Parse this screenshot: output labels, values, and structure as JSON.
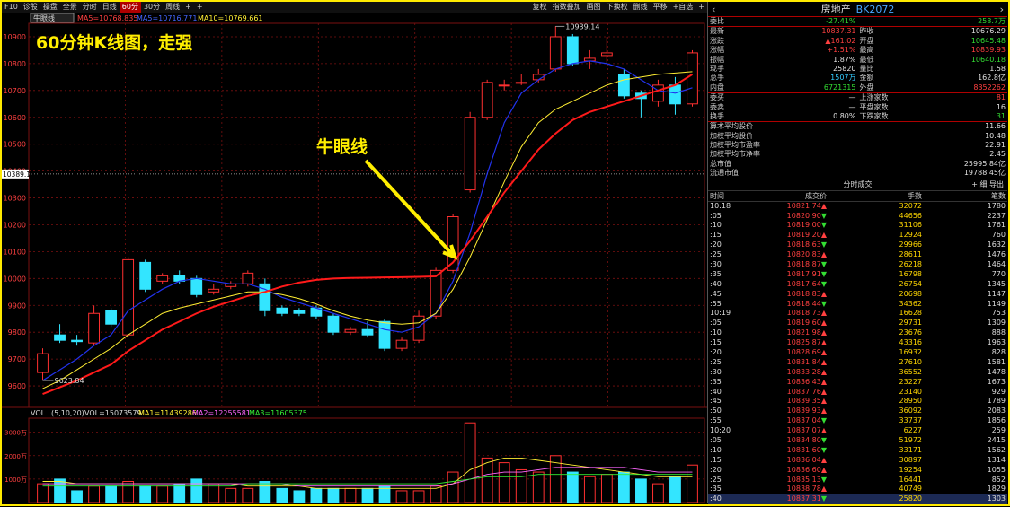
{
  "toolbar": {
    "left": [
      "F10",
      "诊股",
      "操盘",
      "全景"
    ],
    "periods": [
      "分时",
      "日线",
      "60分",
      "30分",
      "周线",
      "+",
      "+"
    ],
    "active_period": "60分",
    "right": [
      "复权",
      "指数叠加",
      "画图",
      "下换权",
      "删线",
      "平移",
      "+自选",
      "+"
    ]
  },
  "indicator_bar": {
    "ma_label": "牛眼线",
    "ma1": "MA5=10768.835",
    "ma2": "MA5=10716.771",
    "ma3": "MA10=10769.661"
  },
  "annotation": {
    "headline": "60分钟K线图，走强",
    "callout": "牛眼线"
  },
  "price_axis": {
    "ticks": [
      "10900",
      "10800",
      "10700",
      "10600",
      "10500",
      "10400",
      "10300",
      "10200",
      "10100",
      "10000",
      "9900",
      "9800",
      "9700",
      "9600"
    ],
    "current_tag": "10389.15",
    "high_label": "10939.14",
    "low_label": "9623.84"
  },
  "volume_panel": {
    "title": "VOL",
    "params": "(5,10,20)",
    "vol": "VOL=15073579",
    "ma1": "MA1=11439286",
    "ma2": "MA2=12255581",
    "ma3": "MA3=11605375",
    "ticks": [
      "3000万",
      "2000万",
      "1000万"
    ]
  },
  "chart_data": {
    "type": "candlestick",
    "candles": [
      {
        "o": 9650,
        "c": 9720,
        "h": 9740,
        "l": 9620
      },
      {
        "o": 9790,
        "c": 9770,
        "h": 9830,
        "l": 9760
      },
      {
        "o": 9770,
        "c": 9765,
        "h": 9790,
        "l": 9750
      },
      {
        "o": 9760,
        "c": 9870,
        "h": 9900,
        "l": 9750
      },
      {
        "o": 9880,
        "c": 9830,
        "h": 9890,
        "l": 9820
      },
      {
        "o": 9790,
        "c": 10070,
        "h": 10080,
        "l": 9780
      },
      {
        "o": 10060,
        "c": 9960,
        "h": 10070,
        "l": 9950
      },
      {
        "o": 9990,
        "c": 10010,
        "h": 10020,
        "l": 9980
      },
      {
        "o": 10010,
        "c": 9990,
        "h": 10030,
        "l": 9980
      },
      {
        "o": 10000,
        "c": 9940,
        "h": 10010,
        "l": 9930
      },
      {
        "o": 9950,
        "c": 9960,
        "h": 9980,
        "l": 9940
      },
      {
        "o": 9970,
        "c": 9980,
        "h": 9990,
        "l": 9960
      },
      {
        "o": 9980,
        "c": 10020,
        "h": 10030,
        "l": 9970
      },
      {
        "o": 9980,
        "c": 9880,
        "h": 10000,
        "l": 9860
      },
      {
        "o": 9890,
        "c": 9870,
        "h": 9900,
        "l": 9860
      },
      {
        "o": 9880,
        "c": 9870,
        "h": 9890,
        "l": 9860
      },
      {
        "o": 9890,
        "c": 9860,
        "h": 9900,
        "l": 9850
      },
      {
        "o": 9860,
        "c": 9800,
        "h": 9870,
        "l": 9790
      },
      {
        "o": 9800,
        "c": 9810,
        "h": 9820,
        "l": 9790
      },
      {
        "o": 9810,
        "c": 9790,
        "h": 9840,
        "l": 9780
      },
      {
        "o": 9840,
        "c": 9740,
        "h": 9850,
        "l": 9730
      },
      {
        "o": 9740,
        "c": 9770,
        "h": 9780,
        "l": 9730
      },
      {
        "o": 9770,
        "c": 9860,
        "h": 9880,
        "l": 9760
      },
      {
        "o": 9860,
        "c": 10030,
        "h": 10040,
        "l": 9850
      },
      {
        "o": 10030,
        "c": 10230,
        "h": 10240,
        "l": 10020
      },
      {
        "o": 10330,
        "c": 10600,
        "h": 10620,
        "l": 10320
      },
      {
        "o": 10600,
        "c": 10730,
        "h": 10740,
        "l": 10590
      },
      {
        "o": 10720,
        "c": 10720,
        "h": 10740,
        "l": 10700
      },
      {
        "o": 10730,
        "c": 10730,
        "h": 10760,
        "l": 10720
      },
      {
        "o": 10740,
        "c": 10760,
        "h": 10780,
        "l": 10730
      },
      {
        "o": 10780,
        "c": 10900,
        "h": 10939,
        "l": 10770
      },
      {
        "o": 10900,
        "c": 10800,
        "h": 10910,
        "l": 10790
      },
      {
        "o": 10810,
        "c": 10820,
        "h": 10850,
        "l": 10780
      },
      {
        "o": 10830,
        "c": 10840,
        "h": 10900,
        "l": 10800
      },
      {
        "o": 10760,
        "c": 10680,
        "h": 10780,
        "l": 10670
      },
      {
        "o": 10690,
        "c": 10670,
        "h": 10700,
        "l": 10600
      },
      {
        "o": 10660,
        "c": 10720,
        "h": 10740,
        "l": 10640
      },
      {
        "o": 10720,
        "c": 10650,
        "h": 10750,
        "l": 10610
      },
      {
        "o": 10650,
        "c": 10840,
        "h": 10850,
        "l": 10640
      }
    ],
    "ma_red": [
      9570,
      9595,
      9620,
      9650,
      9680,
      9730,
      9770,
      9810,
      9840,
      9870,
      9895,
      9915,
      9935,
      9950,
      9970,
      9985,
      9995,
      10000,
      10002,
      10003,
      10004,
      10005,
      10006,
      10008,
      10060,
      10140,
      10230,
      10320,
      10400,
      10480,
      10540,
      10590,
      10620,
      10640,
      10660,
      10680,
      10700,
      10720,
      10760
    ],
    "ma_yellow": [
      9590,
      9620,
      9660,
      9700,
      9740,
      9790,
      9830,
      9870,
      9890,
      9905,
      9920,
      9935,
      9950,
      9950,
      9940,
      9925,
      9905,
      9880,
      9860,
      9845,
      9835,
      9830,
      9835,
      9870,
      9960,
      10080,
      10220,
      10360,
      10490,
      10580,
      10630,
      10660,
      10690,
      10720,
      10740,
      10750,
      10760,
      10765,
      10770
    ],
    "ma_blue": [
      9620,
      9660,
      9700,
      9750,
      9790,
      9880,
      9920,
      9960,
      9990,
      10000,
      9990,
      9980,
      9980,
      9960,
      9930,
      9910,
      9890,
      9870,
      9850,
      9830,
      9810,
      9800,
      9820,
      9870,
      9990,
      10170,
      10390,
      10580,
      10690,
      10740,
      10780,
      10800,
      10810,
      10800,
      10780,
      10740,
      10700,
      10690,
      10710
    ],
    "volume": [
      8,
      10,
      5,
      7,
      7,
      9,
      7,
      7,
      8,
      10,
      8,
      6,
      6,
      9,
      6,
      5,
      6,
      6,
      6,
      6,
      7,
      5,
      5,
      7,
      13,
      34,
      19,
      17,
      14,
      13,
      20,
      13,
      11,
      12,
      13,
      10,
      8,
      11,
      16
    ],
    "vol_ma1": [
      9,
      9,
      8,
      8,
      8,
      8,
      8,
      8,
      8,
      8,
      8,
      8,
      7,
      7,
      7,
      7,
      6,
      6,
      6,
      6,
      6,
      6,
      6,
      6,
      8,
      14,
      17,
      19,
      19,
      18,
      17,
      16,
      15,
      14,
      13,
      12,
      11,
      11,
      11
    ],
    "vol_ma2": [
      8,
      8,
      8,
      8,
      8,
      8,
      8,
      8,
      8,
      8,
      8,
      8,
      8,
      8,
      8,
      7,
      7,
      7,
      7,
      7,
      7,
      7,
      7,
      7,
      8,
      10,
      12,
      13,
      13,
      14,
      15,
      15,
      15,
      15,
      15,
      14,
      13,
      13,
      13
    ],
    "vol_ma3": [
      7,
      7,
      7,
      7,
      7,
      7,
      7,
      7,
      7,
      7,
      7,
      7,
      8,
      8,
      8,
      8,
      8,
      8,
      8,
      8,
      8,
      8,
      8,
      8,
      9,
      10,
      11,
      11,
      11,
      12,
      12,
      12,
      12,
      12,
      12,
      12,
      12,
      12,
      12
    ]
  },
  "stock_header": {
    "name": "房地产",
    "code": "BK2072"
  },
  "quote_rows": [
    [
      {
        "l": "委比",
        "v": "-27.41%",
        "c": "green"
      },
      {
        "l": "",
        "v": "258.7万",
        "c": "green"
      }
    ],
    [
      {
        "l": "最新",
        "v": "10837.31",
        "c": "red"
      },
      {
        "l": "昨收",
        "v": "10676.29",
        "c": "white"
      }
    ],
    [
      {
        "l": "涨跌",
        "v": "▲161.02",
        "c": "red"
      },
      {
        "l": "开盘",
        "v": "10645.48",
        "c": "green"
      }
    ],
    [
      {
        "l": "涨幅",
        "v": "+1.51%",
        "c": "red"
      },
      {
        "l": "最高",
        "v": "10839.93",
        "c": "red"
      }
    ],
    [
      {
        "l": "振幅",
        "v": "1.87%",
        "c": "white"
      },
      {
        "l": "最低",
        "v": "10640.18",
        "c": "green"
      }
    ],
    [
      {
        "l": "现手",
        "v": "25820",
        "c": "white"
      },
      {
        "l": "量比",
        "v": "1.58",
        "c": "white"
      }
    ],
    [
      {
        "l": "总手",
        "v": "1507万",
        "c": "cyan"
      },
      {
        "l": "金额",
        "v": "162.8亿",
        "c": "white"
      }
    ],
    [
      {
        "l": "内盘",
        "v": "6721315",
        "c": "green"
      },
      {
        "l": "外盘",
        "v": "8352262",
        "c": "red"
      }
    ]
  ],
  "breadth_rows": [
    {
      "l": "委买",
      "m": "—",
      "ml": "上涨家数",
      "v": "81",
      "c": "red"
    },
    {
      "l": "委卖",
      "m": "—",
      "ml": "平盘家数",
      "v": "16",
      "c": "white"
    },
    {
      "l": "换手",
      "m": "0.80%",
      "ml": "下跌家数",
      "v": "31",
      "c": "green"
    }
  ],
  "stats_rows": [
    {
      "l": "算术平均股价",
      "v": "11.66"
    },
    {
      "l": "加权平均股价",
      "v": "10.48"
    },
    {
      "l": "加权平均市盈率",
      "v": "22.91"
    },
    {
      "l": "加权平均市净率",
      "v": "2.45"
    },
    {
      "l": "总市值",
      "v": "25995.84亿"
    },
    {
      "l": "流通市值",
      "v": "19788.45亿"
    }
  ],
  "trades_panel": {
    "title": "分时成交",
    "ops": "+ 细  导出",
    "headers": [
      "时间",
      "成交价",
      "手数",
      "笔数"
    ],
    "rows": [
      [
        "10:18",
        "10821.74▲",
        "32072",
        "1780",
        "red"
      ],
      [
        ":05",
        "10820.90▼",
        "44656",
        "2237",
        "red"
      ],
      [
        ":10",
        "10819.00▼",
        "31106",
        "1761",
        "red"
      ],
      [
        ":15",
        "10819.20▲",
        "12924",
        "760",
        "red"
      ],
      [
        ":20",
        "10818.63▼",
        "29966",
        "1632",
        "red"
      ],
      [
        ":25",
        "10820.83▲",
        "28611",
        "1476",
        "red"
      ],
      [
        ":30",
        "10818.87▼",
        "26218",
        "1464",
        "red"
      ],
      [
        ":35",
        "10817.91▼",
        "16798",
        "770",
        "red"
      ],
      [
        ":40",
        "10817.64▼",
        "26754",
        "1345",
        "red"
      ],
      [
        ":45",
        "10818.83▲",
        "20698",
        "1147",
        "red"
      ],
      [
        ":55",
        "10818.44▼",
        "34362",
        "1149",
        "red"
      ],
      [
        "10:19",
        "10818.73▲",
        "16628",
        "753",
        "red"
      ],
      [
        ":05",
        "10819.60▲",
        "29731",
        "1309",
        "red"
      ],
      [
        ":10",
        "10821.98▲",
        "23676",
        "888",
        "red"
      ],
      [
        ":15",
        "10825.87▲",
        "43316",
        "1963",
        "red"
      ],
      [
        ":20",
        "10828.69▲",
        "16932",
        "828",
        "red"
      ],
      [
        ":25",
        "10831.84▲",
        "27610",
        "1581",
        "red"
      ],
      [
        ":30",
        "10833.28▲",
        "36552",
        "1478",
        "red"
      ],
      [
        ":35",
        "10836.43▲",
        "23227",
        "1673",
        "red"
      ],
      [
        ":40",
        "10837.76▲",
        "23140",
        "929",
        "red"
      ],
      [
        ":45",
        "10839.35▲",
        "28950",
        "1789",
        "red"
      ],
      [
        ":50",
        "10839.93▲",
        "36092",
        "2083",
        "red"
      ],
      [
        ":55",
        "10837.04▼",
        "33737",
        "1856",
        "red"
      ],
      [
        "10:20",
        "10837.07▲",
        "6227",
        "259",
        "red"
      ],
      [
        ":05",
        "10834.80▼",
        "51972",
        "2415",
        "red"
      ],
      [
        ":10",
        "10831.60▼",
        "33171",
        "1562",
        "red"
      ],
      [
        ":15",
        "10836.04▲",
        "30897",
        "1314",
        "red"
      ],
      [
        ":20",
        "10836.60▲",
        "19254",
        "1055",
        "red"
      ],
      [
        ":25",
        "10835.13▼",
        "16441",
        "852",
        "red"
      ],
      [
        ":35",
        "10838.78▲",
        "40749",
        "1829",
        "red"
      ],
      [
        ":40",
        "10837.31▼",
        "25820",
        "1303",
        "red"
      ]
    ]
  }
}
